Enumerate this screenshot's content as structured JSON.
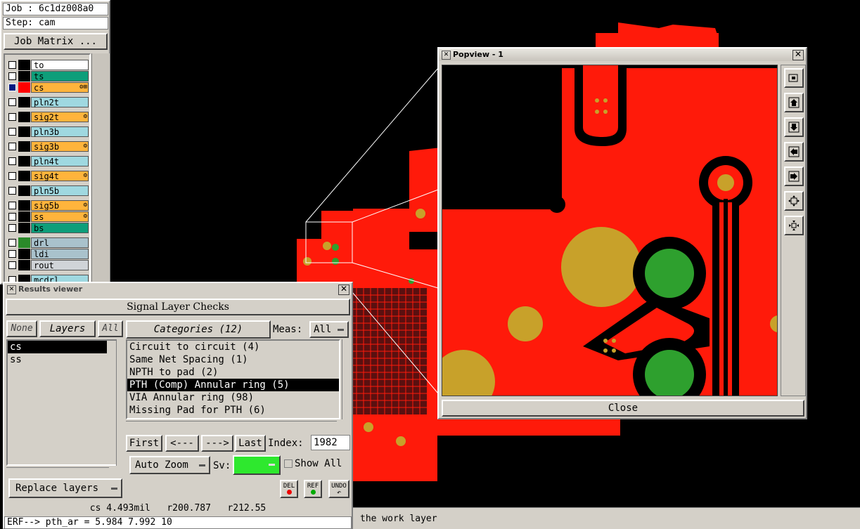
{
  "job": {
    "label": "Job : 6c1dz008a0",
    "step": "Step: cam",
    "matrix_button": "Job Matrix ..."
  },
  "layers": [
    {
      "name": "to",
      "color": "#ffffff",
      "swatch": "#000000",
      "icons": ""
    },
    {
      "name": "ts",
      "color": "#0e9e7a",
      "swatch": "#000000",
      "icons": ""
    },
    {
      "name": "cs",
      "color": "#ffb43c",
      "swatch": "#ff0000",
      "icons": "⚙⊞"
    },
    {
      "name": "pln2t",
      "color": "#9fd8e0",
      "swatch": "#000000",
      "icons": ""
    },
    {
      "name": "sig2t",
      "color": "#ffb43c",
      "swatch": "#000000",
      "icons": "⚙"
    },
    {
      "name": "pln3b",
      "color": "#9fd8e0",
      "swatch": "#000000",
      "icons": ""
    },
    {
      "name": "sig3b",
      "color": "#ffb43c",
      "swatch": "#000000",
      "icons": "⚙"
    },
    {
      "name": "pln4t",
      "color": "#9fd8e0",
      "swatch": "#000000",
      "icons": ""
    },
    {
      "name": "sig4t",
      "color": "#ffb43c",
      "swatch": "#000000",
      "icons": "⚙"
    },
    {
      "name": "pln5b",
      "color": "#9fd8e0",
      "swatch": "#000000",
      "icons": ""
    },
    {
      "name": "sig5b",
      "color": "#ffb43c",
      "swatch": "#000000",
      "icons": "⚙"
    },
    {
      "name": "ss",
      "color": "#ffb43c",
      "swatch": "#000000",
      "icons": "⚙"
    },
    {
      "name": "bs",
      "color": "#0e9e7a",
      "swatch": "#000000",
      "icons": ""
    },
    {
      "name": "drl",
      "color": "#a9c2cc",
      "swatch": "#2a8a2a",
      "icons": ""
    },
    {
      "name": "ldi",
      "color": "#a9c2cc",
      "swatch": "#000000",
      "icons": ""
    },
    {
      "name": "rout",
      "color": "#d0d4d8",
      "swatch": "#000000",
      "icons": ""
    },
    {
      "name": "mcdrl",
      "color": "#9fd8e0",
      "swatch": "#000000",
      "icons": ""
    }
  ],
  "results": {
    "title": "Results viewer",
    "header": "Signal Layer Checks",
    "none_btn": "None",
    "layers_btn": "Layers",
    "all_btn": "All",
    "layer_list": [
      "cs",
      "ss"
    ],
    "categories_btn": "Categories (12)",
    "meas_label": "Meas:",
    "meas_value": "All",
    "categories": [
      "Circuit to circuit (4)",
      "Same Net Spacing (1)",
      "NPTH to pad (2)",
      "PTH (Comp) Annular ring (5)",
      "VIA Annular ring (98)",
      "Missing Pad for PTH (6)"
    ],
    "first_btn": "First",
    "prev_btn": "<---",
    "next_btn": "--->",
    "last_btn": "Last",
    "index_label": "Index:",
    "index_value": "1982",
    "zoom_value": "Auto Zoom",
    "sv_label": "Sv:",
    "show_all_label": "Show All",
    "replace_layers": "Replace layers",
    "del_btn": "DEL",
    "ref_btn": "REF",
    "undo_btn": "UNDO",
    "sv_color": "#2ee82e"
  },
  "status": {
    "measure": "cs 4.493mil   r200.787   r212.55",
    "erf": "ERF--> pth_ar = 5.984 7.992 10",
    "bottom_msg": "the work layer"
  },
  "popview": {
    "title": "Popview - 1",
    "close_btn": "Close"
  },
  "colors": {
    "copper": "#ff1a0a",
    "pad": "#c8a12a",
    "drill": "#2ea02e",
    "panel": "#d4d0c8"
  }
}
